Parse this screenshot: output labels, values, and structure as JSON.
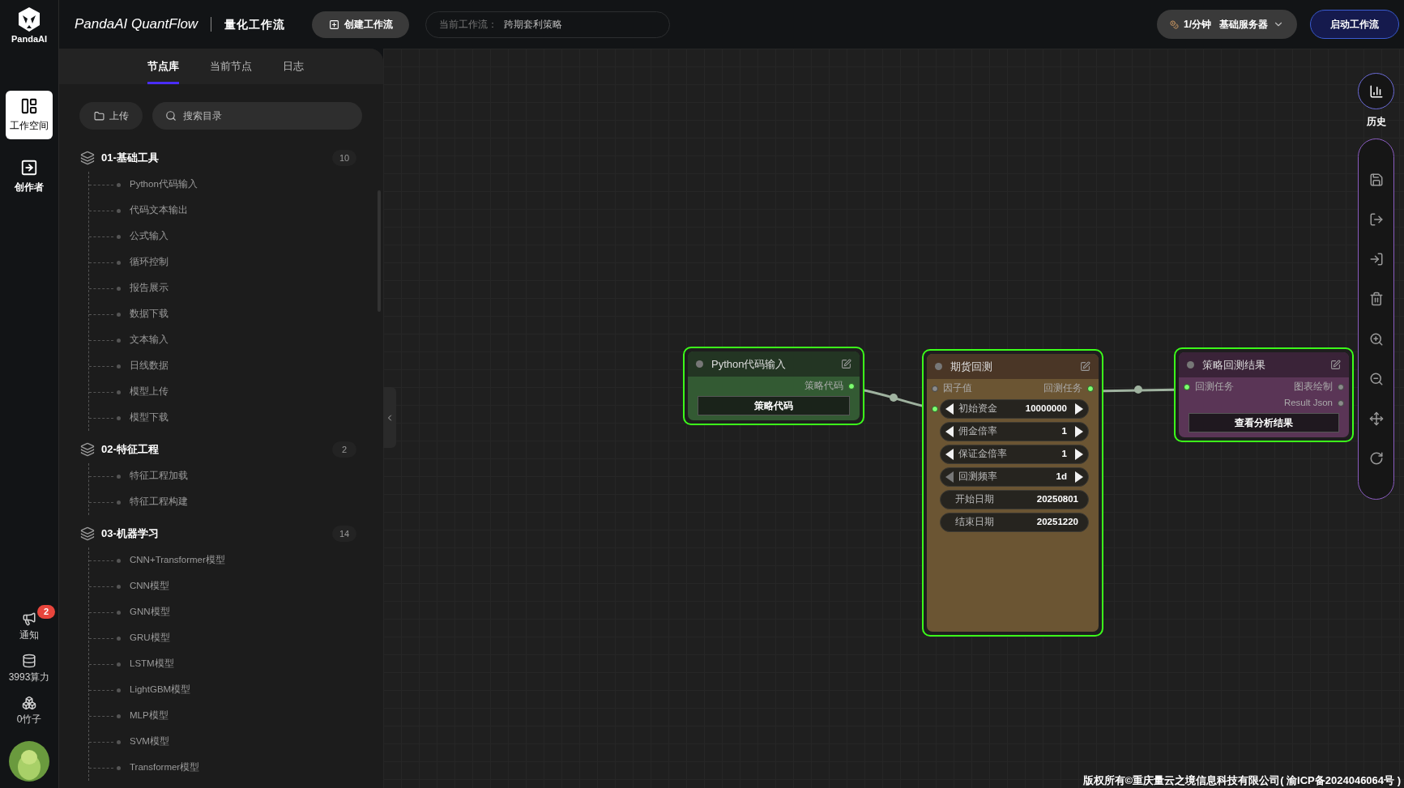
{
  "rail": {
    "logo": "PandaAI",
    "items": [
      {
        "label": "工作空间",
        "selected": true
      },
      {
        "label": "创作者",
        "selected": false
      }
    ],
    "bottom": [
      {
        "kind": "notice",
        "label": "通知",
        "badge": "2"
      },
      {
        "kind": "compute",
        "label": "3993算力"
      },
      {
        "kind": "bamboo",
        "label": "0竹子"
      }
    ]
  },
  "header": {
    "title": "PandaAI QuantFlow",
    "subtitle": "量化工作流",
    "create_button": "创建工作流",
    "current_label": "当前工作流：",
    "current_value": "跨期套利策略",
    "rate": "1/分钟",
    "server": "基础服务器",
    "start_button": "启动工作流"
  },
  "panel": {
    "tabs": [
      {
        "label": "节点库",
        "selected": true
      },
      {
        "label": "当前节点",
        "selected": false
      },
      {
        "label": "日志",
        "selected": false
      }
    ],
    "upload_button": "上传",
    "search_placeholder": "搜索目录",
    "groups": [
      {
        "title": "01-基础工具",
        "count": "10",
        "children": [
          {
            "label": "Python代码输入"
          },
          {
            "label": "代码文本输出"
          },
          {
            "label": "公式输入"
          },
          {
            "label": "循环控制"
          },
          {
            "label": "报告展示"
          },
          {
            "label": "数据下载"
          },
          {
            "label": "文本输入"
          },
          {
            "label": "日线数据"
          },
          {
            "label": "模型上传"
          },
          {
            "label": "模型下载"
          }
        ]
      },
      {
        "title": "02-特征工程",
        "count": "2",
        "children": [
          {
            "label": "特征工程加载"
          },
          {
            "label": "特征工程构建"
          }
        ]
      },
      {
        "title": "03-机器学习",
        "count": "14",
        "children": [
          {
            "label": "CNN+Transformer模型"
          },
          {
            "label": "CNN模型"
          },
          {
            "label": "GNN模型"
          },
          {
            "label": "GRU模型"
          },
          {
            "label": "LSTM模型"
          },
          {
            "label": "LightGBM模型"
          },
          {
            "label": "MLP模型"
          },
          {
            "label": "SVM模型"
          },
          {
            "label": "Transformer模型"
          }
        ]
      }
    ]
  },
  "nodes": [
    {
      "kind": "python",
      "title": "Python代码输入",
      "outputs": [
        {
          "label": "策略代码",
          "connected": true
        }
      ],
      "button": "策略代码"
    },
    {
      "kind": "backtest",
      "title": "期货回测",
      "inputs": [
        {
          "label": "因子值",
          "connected": false
        }
      ],
      "outputs": [
        {
          "label": "回测任务",
          "connected": true
        }
      ],
      "widgets": [
        {
          "kind": "number",
          "label": "初始资金",
          "value": "10000000",
          "linked": true,
          "at_min": false
        },
        {
          "kind": "number",
          "label": "佣金倍率",
          "value": "1",
          "linked": false,
          "at_min": false
        },
        {
          "kind": "number",
          "label": "保证金倍率",
          "value": "1",
          "linked": false,
          "at_min": false
        },
        {
          "kind": "number",
          "label": "回测频率",
          "value": "1d",
          "linked": false,
          "at_min": true
        },
        {
          "kind": "text",
          "label": "开始日期",
          "value": "20250801"
        },
        {
          "kind": "text",
          "label": "结束日期",
          "value": "20251220"
        }
      ]
    },
    {
      "kind": "result",
      "title": "策略回测结果",
      "inputs": [
        {
          "label": "回测任务",
          "connected": true
        }
      ],
      "outputs": [
        {
          "label": "图表绘制",
          "connected": false
        },
        {
          "label": "Result Json",
          "connected": false
        }
      ],
      "button": "查看分析结果"
    }
  ],
  "toolbar": {
    "history_label": "历史"
  },
  "footer": "版权所有©重庆量云之境信息科技有限公司( 渝ICP备2024046064号 )"
}
